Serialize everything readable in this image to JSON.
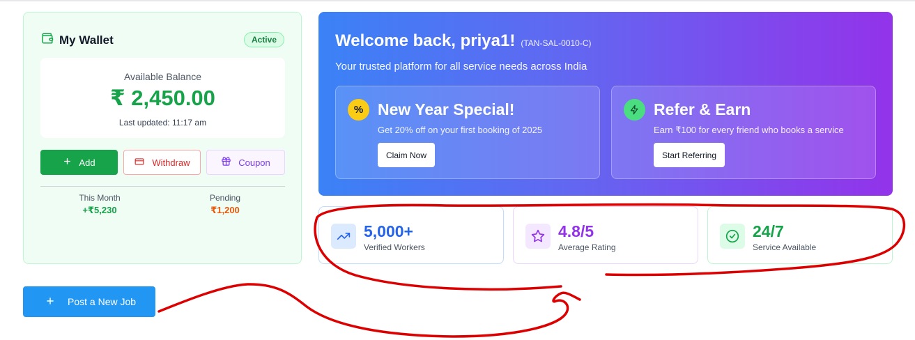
{
  "wallet": {
    "title": "My Wallet",
    "status": "Active",
    "balance_label": "Available Balance",
    "balance": "₹ 2,450.00",
    "updated": "Last updated: 11:17 am",
    "add_label": "Add",
    "withdraw_label": "Withdraw",
    "coupon_label": "Coupon",
    "this_month_label": "This Month",
    "this_month_value": "+₹5,230",
    "pending_label": "Pending",
    "pending_value": "₹1,200"
  },
  "post_job_label": "Post a New Job",
  "hero": {
    "title": "Welcome back, priya1!",
    "user_code": "(TAN-SAL-0010-C)",
    "subtitle": "Your trusted platform for all service needs across India",
    "promos": [
      {
        "icon": "%",
        "title": "New Year Special!",
        "desc": "Get 20% off on your first booking of 2025",
        "button": "Claim Now"
      },
      {
        "icon": "lightning-icon",
        "title": "Refer & Earn",
        "desc": "Earn ₹100 for every friend who books a service",
        "button": "Start Referring"
      }
    ]
  },
  "stats": [
    {
      "value": "5,000+",
      "label": "Verified Workers",
      "icon": "trending-up-icon",
      "color": "#2563eb"
    },
    {
      "value": "4.8/5",
      "label": "Average Rating",
      "icon": "star-icon",
      "color": "#9333ea"
    },
    {
      "value": "24/7",
      "label": "Service Available",
      "icon": "check-circle-icon",
      "color": "#16a34a"
    }
  ],
  "colors": {
    "wallet_green": "#16a34a",
    "withdraw_red": "#dc2626",
    "coupon_purple": "#7c3aed",
    "post_job_blue": "#2196f3",
    "pending_orange": "#ea580c",
    "annotation_red": "#dc0000"
  }
}
